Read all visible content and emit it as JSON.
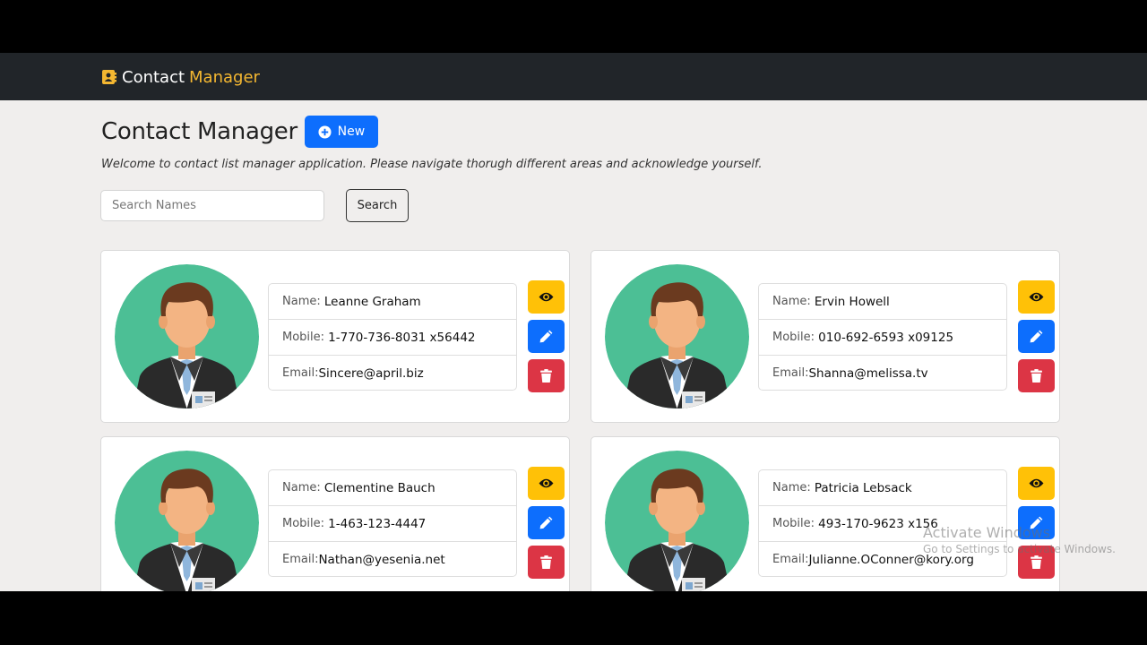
{
  "navbar": {
    "brand_part1": "Contact",
    "brand_part2": "Manager",
    "brand_icon": "address-book-icon"
  },
  "header": {
    "title": "Contact Manager",
    "new_button": "New",
    "new_icon": "plus-circle-icon"
  },
  "welcome": "Welcome to contact list manager application. Please navigate thorugh different areas and acknowledge yourself.",
  "search": {
    "placeholder": "Search Names",
    "button": "Search"
  },
  "labels": {
    "name": "Name:",
    "mobile": "Mobile:",
    "email": "Email:"
  },
  "contacts": [
    {
      "name": "Leanne Graham",
      "mobile": "1-770-736-8031 x56442",
      "email": "Sincere@april.biz"
    },
    {
      "name": "Ervin Howell",
      "mobile": "010-692-6593 x09125",
      "email": "Shanna@melissa.tv"
    },
    {
      "name": "Clementine Bauch",
      "mobile": "1-463-123-4447",
      "email": "Nathan@yesenia.net"
    },
    {
      "name": "Patricia Lebsack",
      "mobile": "493-170-9623 x156",
      "email": "Julianne.OConner@kory.org"
    }
  ],
  "icons": {
    "view": "eye-icon",
    "edit": "pencil-icon",
    "delete": "trash-icon",
    "avatar": "businessman-avatar-icon"
  },
  "colors": {
    "navbar": "#212529",
    "brand_accent": "#f4b731",
    "primary": "#0d6efd",
    "warning": "#ffc107",
    "danger": "#dc3545",
    "avatar_bg": "#4cbf95"
  },
  "watermark": {
    "line1": "Activate Windows",
    "line2": "Go to Settings to activate Windows."
  }
}
